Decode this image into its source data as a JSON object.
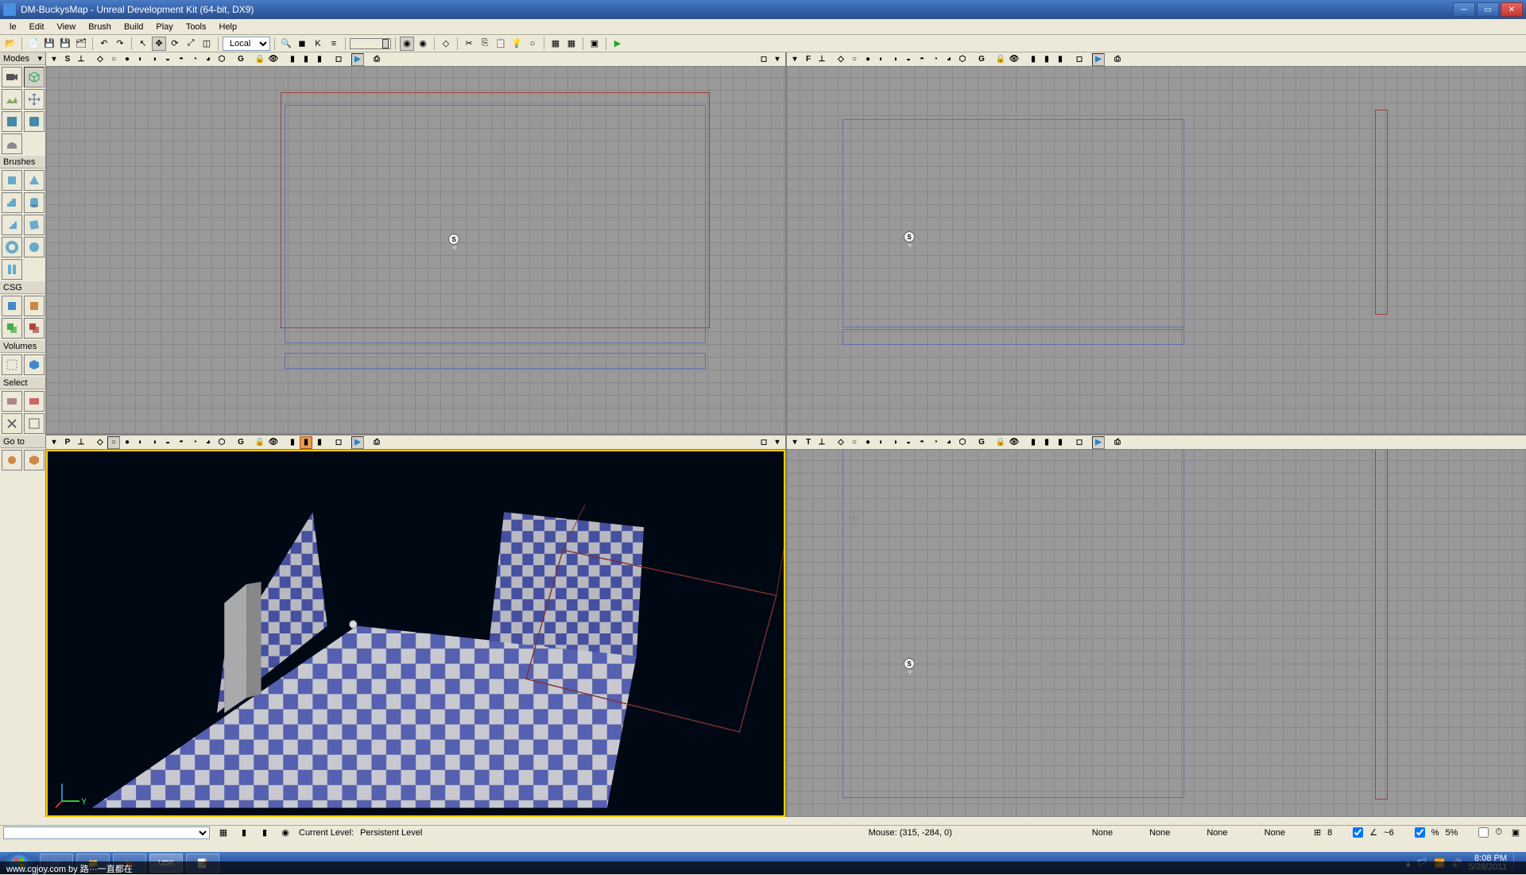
{
  "window": {
    "title": "DM-BuckysMap - Unreal Development Kit (64-bit, DX9)"
  },
  "menu": {
    "items": [
      "le",
      "Edit",
      "View",
      "Brush",
      "Build",
      "Play",
      "Tools",
      "Help"
    ]
  },
  "toolbar": {
    "coord_space": "Local"
  },
  "left_panel": {
    "modes": "Modes",
    "brushes": "Brushes",
    "csg": "CSG",
    "volumes": "Volumes",
    "select": "Select",
    "goto": "Go to"
  },
  "viewports": {
    "top_left": {
      "label": "S"
    },
    "top_right": {
      "label": "F"
    },
    "bottom_left": {
      "label": "P"
    },
    "bottom_right": {
      "label": "T"
    }
  },
  "bottom": {
    "current_level_label": "Current Level:",
    "current_level_value": "Persistent Level"
  },
  "status": {
    "mouse": "Mouse: (315, -284, 0)",
    "none1": "None",
    "none2": "None",
    "none3": "None",
    "none4": "None",
    "grid_value": "8",
    "rot_value": "~6",
    "scale_value": "5%"
  },
  "taskbar": {
    "time": "8:08 PM",
    "date": "5/28/2011"
  },
  "watermark": "www.cgjoy.com by 路···一直都在"
}
